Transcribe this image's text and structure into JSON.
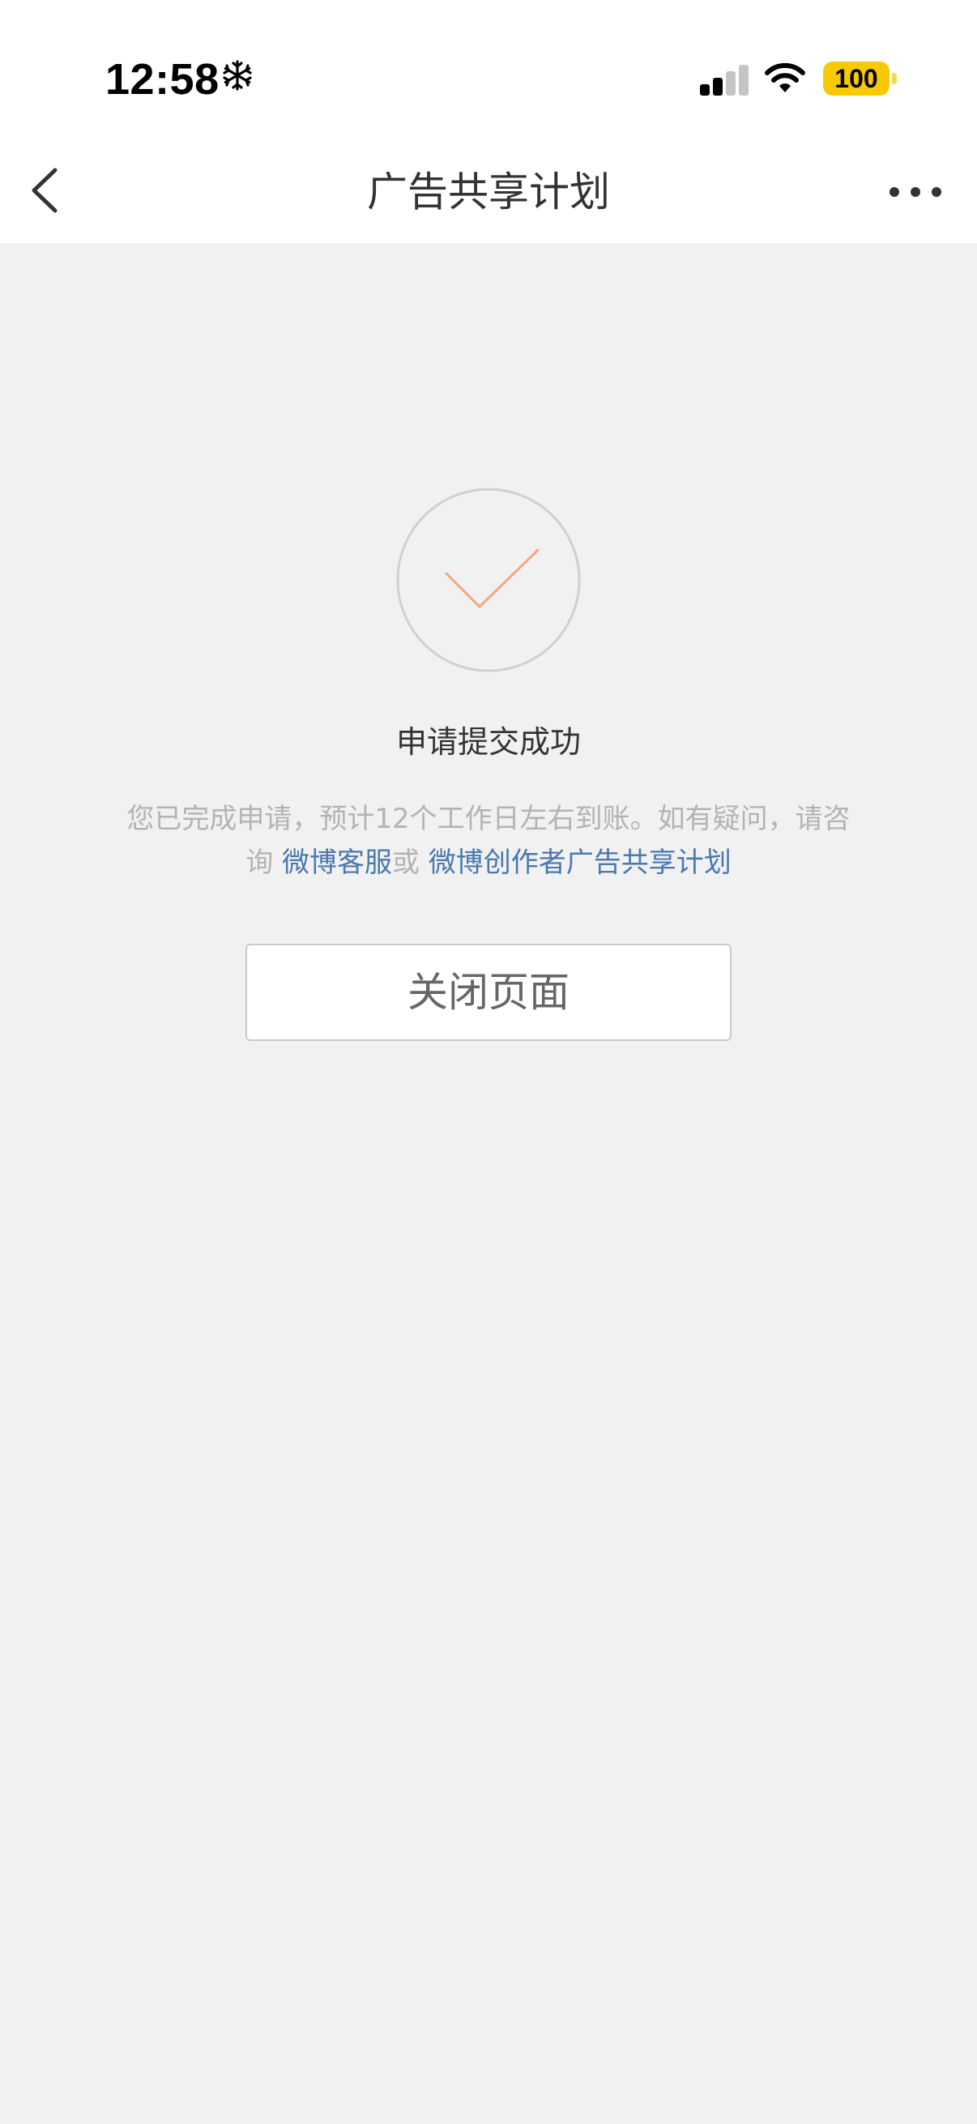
{
  "status_bar": {
    "time": "12:58",
    "battery": "100",
    "snow_icon": "snowflake-icon",
    "colors": {
      "battery": "#f7c900"
    }
  },
  "nav": {
    "title": "广告共享计划",
    "back_icon": "chevron-left-icon",
    "more_icon": "more-dots-icon"
  },
  "result": {
    "icon": "check-circle-icon",
    "title": "申请提交成功",
    "desc_prefix": "您已完成申请，预计12个工作日左右到账。如有疑问，请咨询 ",
    "link_service": "微博客服",
    "desc_or": "或 ",
    "link_plan": "微博创作者广告共享计划",
    "close_button": "关闭页面",
    "colors": {
      "check": "#f4a77e",
      "link": "#4a78b0"
    }
  }
}
